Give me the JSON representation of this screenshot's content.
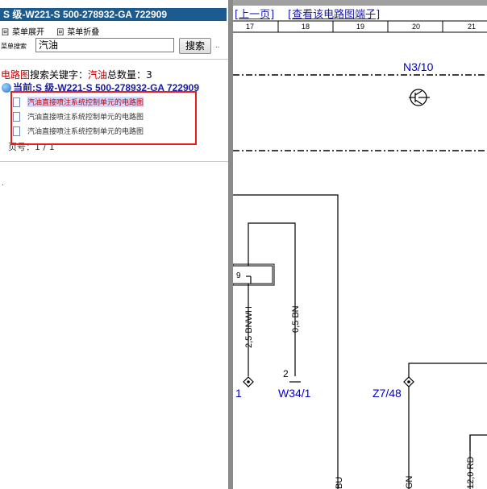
{
  "left": {
    "title": "S 级-W221-S 500-278932-GA 722909",
    "menu_expand": "菜单展开",
    "menu_collapse": "菜单折叠",
    "square_glyph": "回",
    "search_label": "菜单搜索",
    "search_value": "汽油",
    "search_button": "搜索",
    "search_extra": "..",
    "result_prefix": "电路图",
    "result_mid": "搜索关键字：",
    "result_keyword": "汽油",
    "result_count_label": "总数量：",
    "result_count": "3",
    "tree_root": "当前:S 级-W221-S 500-278932-GA 722909",
    "items": [
      "汽油直接喷注系统控制单元的电路图",
      "汽油直接喷注系统控制单元的电路图",
      "汽油直接喷注系统控制单元的电路图"
    ],
    "page_label": "页号：",
    "page_value": "1 / 1",
    "dot_mark": "."
  },
  "right": {
    "prev_link": "[上一页]",
    "terminals_link": "[查看该电路图端子]",
    "columns": [
      "17",
      "18",
      "19",
      "20",
      "21"
    ],
    "component_top": "N3/10",
    "pin_9": "9",
    "wire_1": "2,5 BNWH",
    "wire_2": "0,5 BN",
    "pin_2": "2",
    "conn_left": "1",
    "conn_w34": "W34/1",
    "conn_z7": "Z7/48",
    "wire_bu": "BU",
    "wire_gn": "GN",
    "wire_rd": "12,0 RD"
  },
  "colors": {
    "title_bar": "#1b5b8f",
    "highlight": "#e02020",
    "link": "#1a1aa8",
    "label_blue": "#0000cc"
  }
}
